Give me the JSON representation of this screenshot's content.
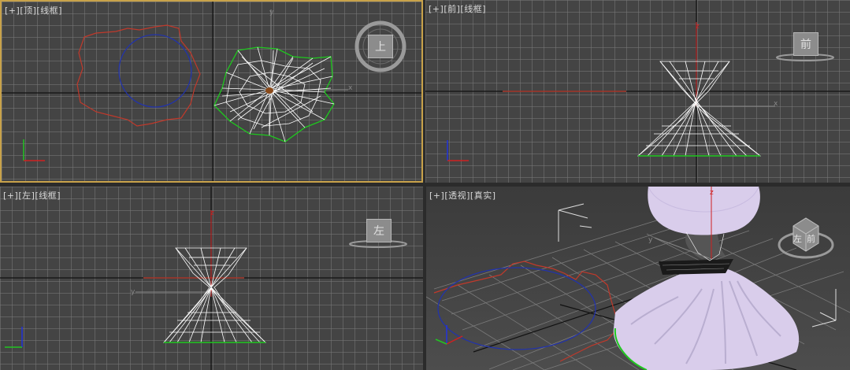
{
  "viewports": {
    "top": {
      "label_plus": "[+]",
      "label_view": "[顶]",
      "label_mode": "[线框]",
      "axis_y": "y",
      "axis_x": "x",
      "cube_face": "上"
    },
    "front": {
      "label_plus": "[+]",
      "label_view": "[前]",
      "label_mode": "[线框]",
      "axis_z": "z",
      "axis_x": "x",
      "cube_face": "前"
    },
    "left": {
      "label_plus": "[+]",
      "label_view": "[左]",
      "label_mode": "[线框]",
      "axis_z": "z",
      "axis_y": "y",
      "cube_face": "左"
    },
    "perspective": {
      "label_plus": "[+]",
      "label_view": "[透视]",
      "label_mode": "[真实]",
      "axis_z": "z",
      "axis_y": "y",
      "cube_face_1": "左",
      "cube_face_2": "前"
    }
  },
  "colors": {
    "active_border": "#c8a24a",
    "spline_red": "#c0392b",
    "circle_blue": "#2233aa",
    "wire_white": "#ffffff",
    "selection_green": "#1ec81e",
    "mesh_lavender": "#d9cdeb"
  }
}
